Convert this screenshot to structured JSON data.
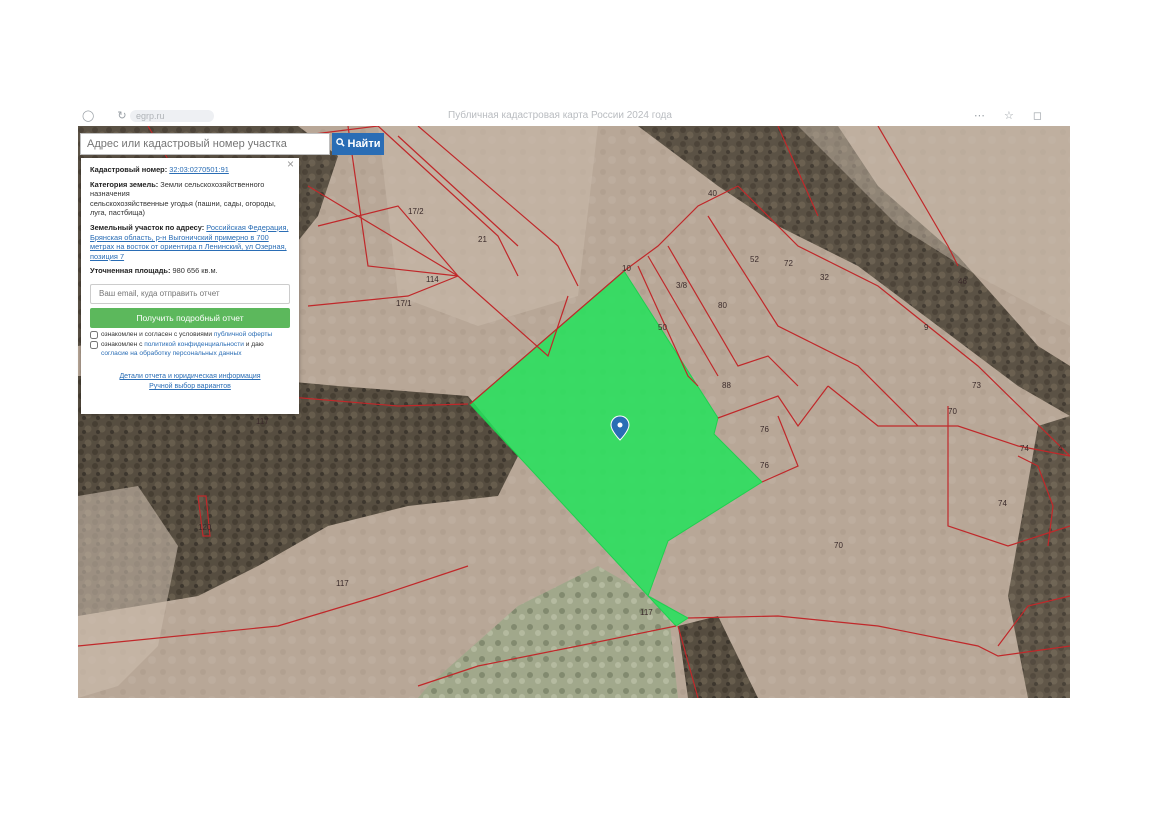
{
  "browser": {
    "url": "egrp.ru",
    "title": "Публичная кадастровая карта России 2024 года"
  },
  "search": {
    "placeholder": "Адрес или кадастровый номер участка",
    "button_label": "Найти"
  },
  "info_panel": {
    "close_label": "×",
    "cadastral_label": "Кадастровый номер:",
    "cadastral_number": "32:03:0270501:91",
    "category_label": "Категория земель:",
    "category_value": "Земли сельскохозяйственного назначения",
    "category_detail": "сельскохозяйственные угодья (пашни, сады, огороды, луга, пастбища)",
    "address_label": "Земельный участок по адресу:",
    "address_value": "Российская Федерация, Брянская область, р-н Выгоничский примерно в 700 метрах на восток от ориентира п Ленинский, ул Озерная, позиция 7",
    "area_label": "Уточненная площадь:",
    "area_value": "980 656 кв.м.",
    "email_placeholder": "Ваш email, куда отправить отчет",
    "report_button": "Получить подробный отчет",
    "consent1_text": "ознакомлен и согласен с условиями",
    "consent1_link": "публичной оферты",
    "consent2_text": "ознакомлен с",
    "consent2_link": "политикой конфиденциальности",
    "consent2_and": "и даю",
    "consent2_link2": "согласие на обработку персональных данных",
    "details_link": "Детали отчета и юридическая информация",
    "manual_link": "Ручной выбор вариантов"
  },
  "map": {
    "highlight_color": "#22e35a",
    "boundary_color": "#c0282a",
    "parcel_labels": [
      "17/2",
      "21",
      "114",
      "17/1",
      "117",
      "117",
      "117",
      "10",
      "3/8",
      "50",
      "80",
      "88",
      "76",
      "76",
      "40",
      "46",
      "52",
      "72",
      "9",
      "73",
      "70",
      "74",
      "74",
      "4",
      "70",
      "120",
      "32"
    ]
  }
}
